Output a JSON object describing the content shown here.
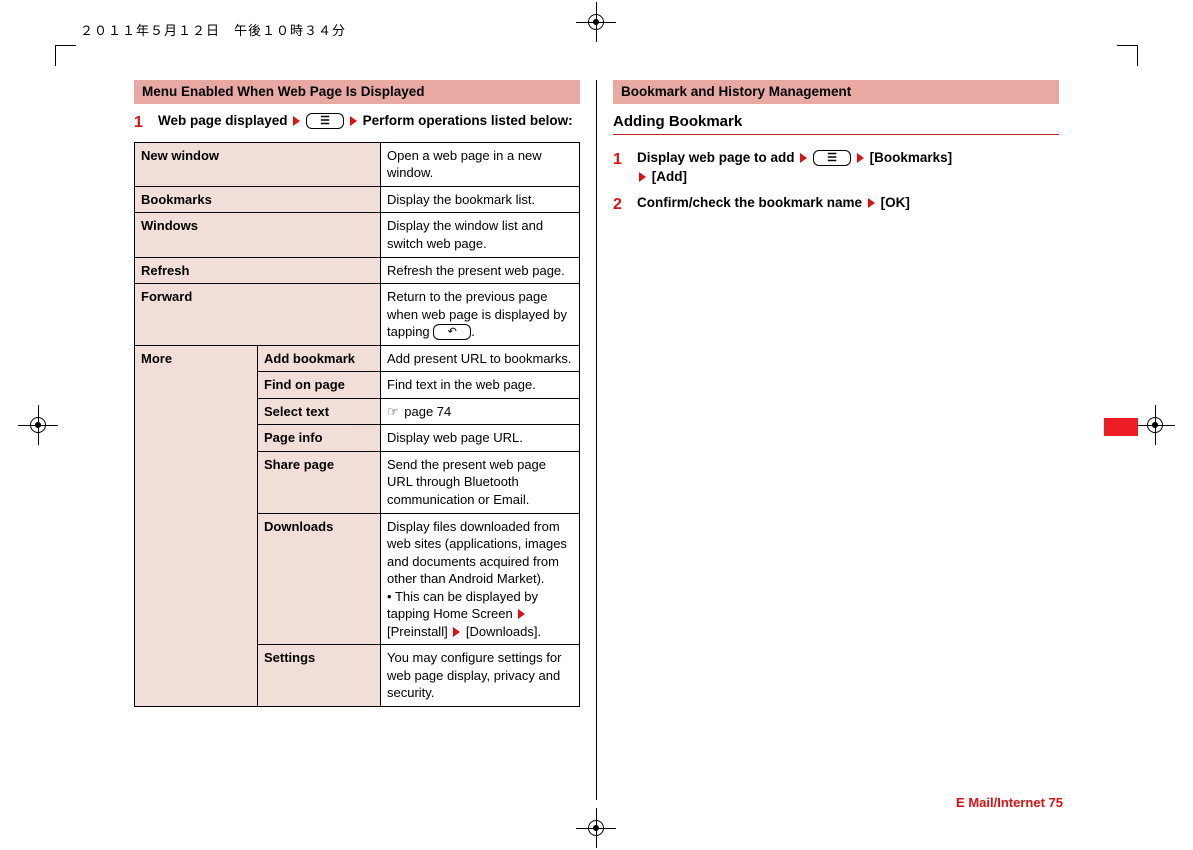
{
  "header_timestamp": "２０１１年５月１２日　午後１０時３４分",
  "left": {
    "section_title": "Menu Enabled When Web Page Is Displayed",
    "step1": {
      "num": "1",
      "pre": "Web page displayed",
      "key1": "☰",
      "post": "Perform operations listed below:"
    },
    "rows": {
      "new_window": {
        "label": "New window",
        "desc": "Open a web page in a new window."
      },
      "bookmarks": {
        "label": "Bookmarks",
        "desc": "Display the bookmark list."
      },
      "windows": {
        "label": "Windows",
        "desc": "Display the window list and switch web page."
      },
      "refresh": {
        "label": "Refresh",
        "desc": "Refresh the present web page."
      },
      "forward": {
        "label": "Forward",
        "desc": "Return to the previous page when web page is displayed by tapping ",
        "desc_tail": "."
      },
      "more_label": "More",
      "more": {
        "add_bookmark": {
          "label": "Add bookmark",
          "desc": "Add present URL to bookmarks."
        },
        "find_on_page": {
          "label": "Find on page",
          "desc": "Find text in the web page."
        },
        "select_text": {
          "label": "Select text",
          "desc": " page 74"
        },
        "page_info": {
          "label": "Page info",
          "desc": "Display web page URL."
        },
        "share_page": {
          "label": "Share page",
          "desc": "Send the present web page URL through Bluetooth communication or Email."
        },
        "downloads": {
          "label": "Downloads",
          "desc": "Display files downloaded from web sites (applications, images and documents acquired from other than Android Market).",
          "bullet": "This can be displayed by tapping Home Screen ",
          "bullet_mid": " [Preinstall] ",
          "bullet_tail": " [Downloads]."
        },
        "settings": {
          "label": "Settings",
          "desc": "You may configure settings for web page display, privacy and security."
        }
      }
    }
  },
  "right": {
    "section_title": "Bookmark and History Management",
    "sub_title": "Adding Bookmark",
    "step1": {
      "num": "1",
      "pre": "Display web page to add",
      "key1": "☰",
      "mid": "[Bookmarks]",
      "tail": "[Add]"
    },
    "step2": {
      "num": "2",
      "pre": "Confirm/check the bookmark name",
      "tail": "[OK]"
    }
  },
  "footer": {
    "section": "E Mail/Internet",
    "page": "75"
  }
}
